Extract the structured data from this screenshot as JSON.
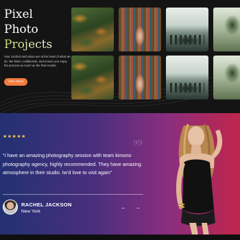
{
  "hero": {
    "title_line1": "Pixel",
    "title_line2": "Photo",
    "title_line3": "Projects",
    "description": "Your comfort and vision are at the heart of what we do. We listen, collaborate, and ensure you enjoy the process as much as the final results.",
    "button_label": "View More",
    "accent_color": "#f47b3e"
  },
  "gallery": {
    "row1": [
      {
        "icon": "forest-photo"
      },
      {
        "icon": "library-photo"
      },
      {
        "icon": "street-photo"
      },
      {
        "icon": "tree-photo"
      }
    ],
    "row2": [
      {
        "icon": "forest-photo"
      },
      {
        "icon": "library-photo"
      },
      {
        "icon": "street-photo"
      },
      {
        "icon": "tree-photo"
      }
    ]
  },
  "testimonial": {
    "stars": "★★★★★",
    "rating": 5,
    "quote_symbol": "99",
    "quote": "“I have an amazing photography session with team kimono photography agency, highly recommended. They have amazing atmosphere in their studio. Iw’d love to visit again”",
    "author_name": "RACHEL JACKSON",
    "author_city": "New York",
    "prev_icon": "←",
    "next_icon": "→",
    "gradient_start": "#233072",
    "gradient_end": "#c0254b"
  }
}
